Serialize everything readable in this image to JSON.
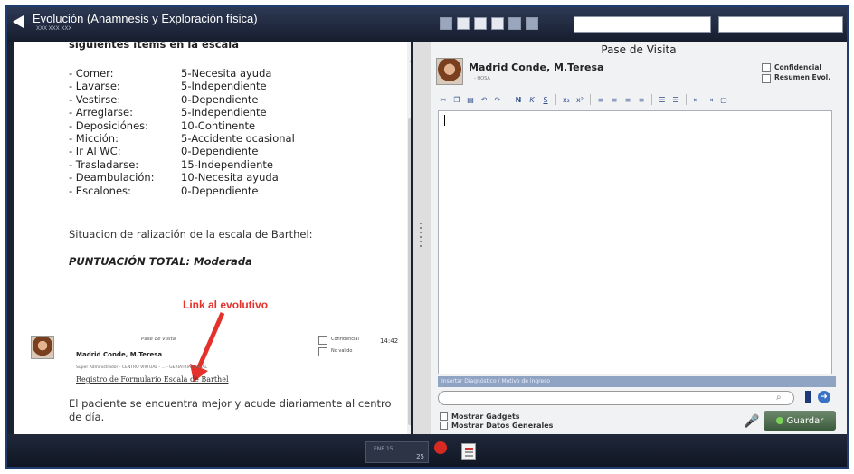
{
  "window": {
    "title": "Evolución (Anamnesis y Exploración física)",
    "subtitle": "XXX XXX XXX"
  },
  "left": {
    "heading": "siguientes ítems en la escala",
    "items": [
      {
        "name": "- Comer:",
        "value": "5-Necesita ayuda"
      },
      {
        "name": "- Lavarse:",
        "value": "5-Independiente"
      },
      {
        "name": "- Vestirse:",
        "value": "0-Dependiente"
      },
      {
        "name": "- Arreglarse:",
        "value": "5-Independiente"
      },
      {
        "name": "- Deposiciónes:",
        "value": "10-Continente"
      },
      {
        "name": "- Micción:",
        "value": "5-Accidente ocasional"
      },
      {
        "name": "- Ir Al WC:",
        "value": "0-Dependiente"
      },
      {
        "name": "- Trasladarse:",
        "value": "15-Independiente"
      },
      {
        "name": "- Deambulación:",
        "value": "10-Necesita ayuda"
      },
      {
        "name": "- Escalones:",
        "value": " 0-Dependiente"
      }
    ],
    "situacion": "Situacion de ralización de la escala de Barthel:",
    "total": "PUNTUACIÓN TOTAL: Moderada",
    "link_label": "Link al evolutivo",
    "entry": {
      "pase": "Pase de visita",
      "author": "Madrid Conde, M.Teresa",
      "meta": "Super Administrador - CENTRO VIRTUAL - ... - GERIATRIA/SOCIAL",
      "link_text": "Registro de Formulario Escala de Barthel",
      "confidencial": "Confidencial",
      "no_valido": "No valido",
      "time": "14:42"
    },
    "final_text": "El paciente se encuentra mejor y acude diariamente al centro de día."
  },
  "right": {
    "title": "Pase de Visita",
    "doctor": "Madrid Conde, M.Teresa",
    "doctor_sub": "- HOSA",
    "confidencial": "Confidencial",
    "resumen": "Resumen Evol.",
    "gadget_bar": "Insertar Diagnóstico / Motivo de ingreso",
    "mostrar_gadgets": "Mostrar Gadgets",
    "mostrar_datos": "Mostrar Datos Generales",
    "save_label": "Guardar"
  },
  "bottom": {
    "date_label": "ENE 15",
    "date_num": "25"
  }
}
